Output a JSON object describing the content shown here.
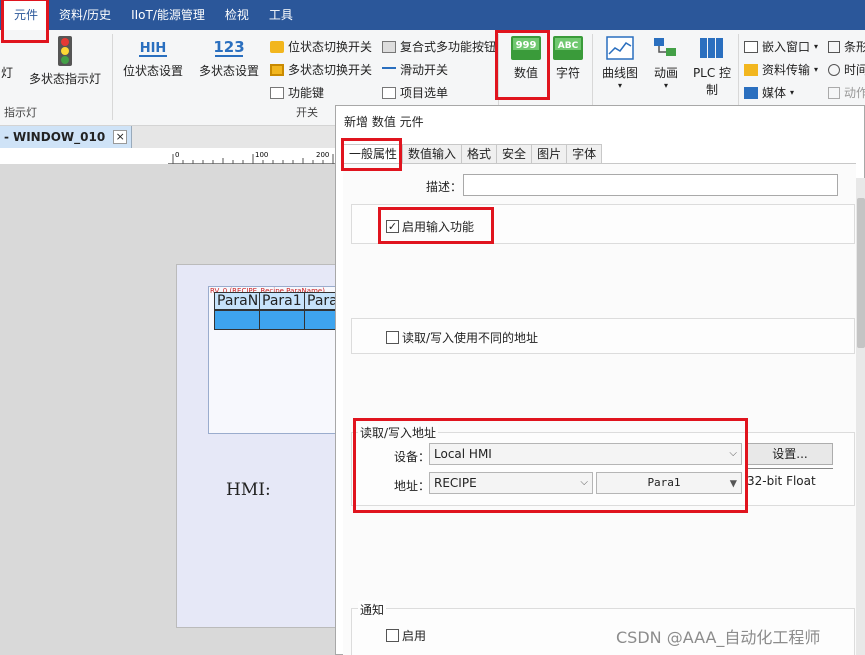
{
  "menubar": {
    "items": [
      "元件",
      "资料/历史",
      "IIoT/能源管理",
      "检视",
      "工具"
    ]
  },
  "ribbon": {
    "indicator_group": {
      "partial_label": "灯",
      "multi_state_lamp": "多状态指示灯",
      "group_label": "指示灯"
    },
    "switch_group": {
      "bit_setting": "位状态设置",
      "multi_setting": "多状态设置",
      "small_items": [
        "位状态切换开关",
        "多状态切换开关",
        "功能键",
        "复合式多功能按钮",
        "滑动开关",
        "项目选单"
      ],
      "group_label": "开关"
    },
    "numeric": {
      "label": "数值",
      "icon_text": "999"
    },
    "character": {
      "label": "字符",
      "icon_text": "ABC"
    },
    "trend": {
      "label": "曲线图"
    },
    "animation": {
      "label": "动画"
    },
    "plc": {
      "label_line1": "PLC 控",
      "label_line2": "制"
    },
    "right_items": [
      "嵌入窗口",
      "资料传输",
      "媒体"
    ],
    "far_right_items": [
      "条形",
      "时间",
      "动作"
    ],
    "bit_icon_text": "HIH",
    "multi_icon_text": "123"
  },
  "doc_tab": {
    "label": "WINDOW_010",
    "close": "×"
  },
  "ruler": {
    "ticks": [
      "0",
      "100",
      "200"
    ]
  },
  "canvas": {
    "recipe_label": "RV_0 (RECIPE_Recipe ParaName)",
    "headers": [
      "ParaN",
      "Para1",
      "Para"
    ],
    "hmi_text": "HMI:"
  },
  "dialog": {
    "title": "新增 数值 元件",
    "tabs": [
      "一般属性",
      "数值输入",
      "格式",
      "安全",
      "图片",
      "字体"
    ],
    "description_label": "描述：",
    "description_value": "",
    "enable_input_label": "启用输入功能",
    "enable_input_checked": true,
    "different_rw_label": "读取/写入使用不同的地址",
    "different_rw_checked": false,
    "rw_address_section": "读取/写入地址",
    "device_label": "设备：",
    "device_value": "Local HMI",
    "settings_button": "设置...",
    "address_label": "地址：",
    "address_value": "RECIPE",
    "param_value": "Para1",
    "data_type": "32-bit Float",
    "notify_section": "通知",
    "notify_enable_label": "启用",
    "notify_checked": false
  },
  "watermark": "CSDN @AAA_自动化工程师",
  "colors": {
    "menubar": "#2b579a",
    "highlight": "#e0141e",
    "recipe_cell": "#3ea4ee"
  }
}
